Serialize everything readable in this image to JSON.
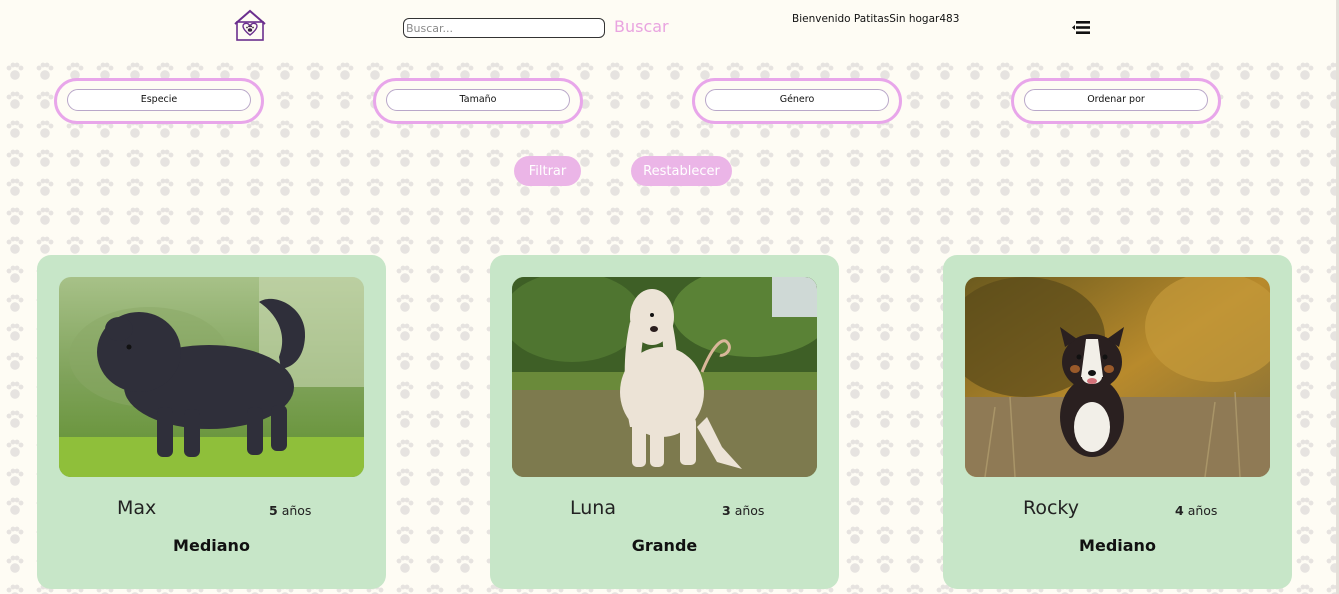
{
  "header": {
    "search_placeholder": "Buscar...",
    "search_button": "Buscar",
    "welcome_text": "Bienvenido PatitasSin hogar483"
  },
  "filters": [
    {
      "label": "Especie"
    },
    {
      "label": "Tamaño"
    },
    {
      "label": "Género"
    },
    {
      "label": "Ordenar por"
    }
  ],
  "actions": {
    "filter_label": "Filtrar",
    "reset_label": "Restablecer"
  },
  "colors": {
    "accent_pink": "#e8a6ea",
    "card_green": "#c7e6c8",
    "background": "#fefcf4"
  },
  "pets": [
    {
      "name": "Max",
      "age_value": "5",
      "age_unit": "años",
      "size": "Mediano"
    },
    {
      "name": "Luna",
      "age_value": "3",
      "age_unit": "años",
      "size": "Grande"
    },
    {
      "name": "Rocky",
      "age_value": "4",
      "age_unit": "años",
      "size": "Mediano"
    }
  ]
}
